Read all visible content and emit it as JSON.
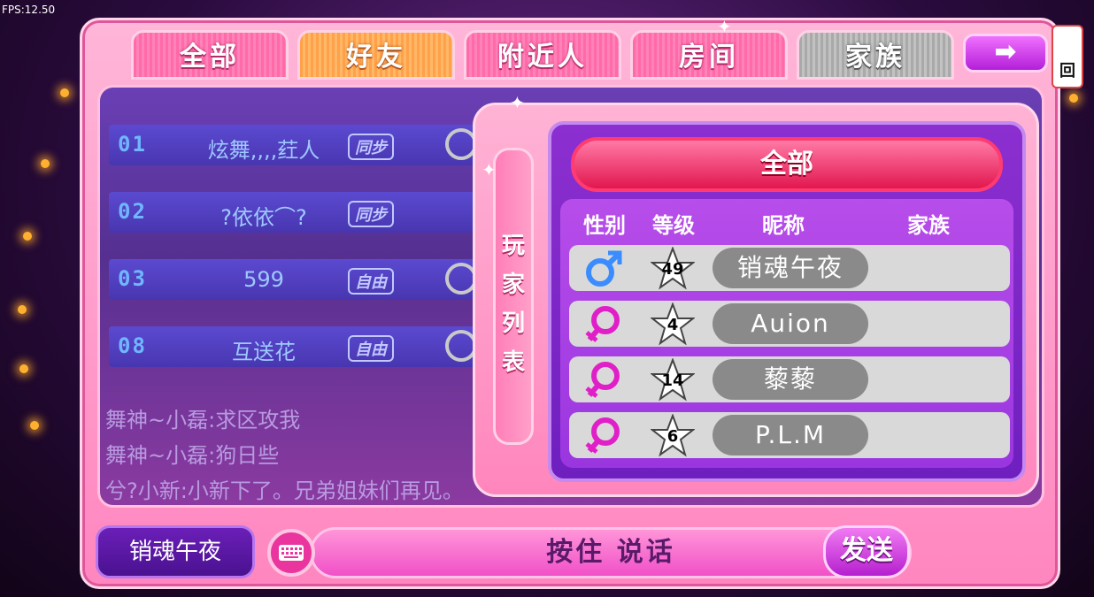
{
  "fps": "FPS:12.50",
  "tabs": [
    {
      "label": "全部",
      "state": "normal"
    },
    {
      "label": "好友",
      "state": "active"
    },
    {
      "label": "附近人",
      "state": "normal"
    },
    {
      "label": "房间",
      "state": "normal"
    },
    {
      "label": "家族",
      "state": "disabled"
    }
  ],
  "arrow_button": "➡",
  "back_label": "回",
  "rooms": [
    {
      "num": "01",
      "name": "炫舞,,,,荭人",
      "mode": "同步"
    },
    {
      "num": "02",
      "name": "?依依⌒?",
      "mode": "同步"
    },
    {
      "num": "03",
      "name": "599",
      "mode": "自由"
    },
    {
      "num": "08",
      "name": "互送花",
      "mode": "自由"
    }
  ],
  "chat": [
    "舞神~小磊:求区攻我",
    "舞神~小磊:狗日些",
    "兮?小新:小新下了。兄弟姐妹们再见。"
  ],
  "player_list": {
    "side_title": [
      "玩",
      "家",
      "列",
      "表"
    ],
    "filter_button": "全部",
    "headers": {
      "gender": "性别",
      "level": "等级",
      "nickname": "昵称",
      "family": "家族"
    },
    "players": [
      {
        "gender": "male",
        "gender_icon": "male-icon",
        "level": "49",
        "nickname": "销魂午夜",
        "family": ""
      },
      {
        "gender": "female",
        "gender_icon": "female-icon",
        "level": "4",
        "nickname": "Auion",
        "family": ""
      },
      {
        "gender": "female",
        "gender_icon": "female-icon",
        "level": "14",
        "nickname": "藜藜",
        "family": ""
      },
      {
        "gender": "female",
        "gender_icon": "female-icon",
        "level": "6",
        "nickname": "P.L.M",
        "family": ""
      }
    ]
  },
  "bottom": {
    "player_name": "销魂午夜",
    "keyboard_icon": "keyboard-icon",
    "voice_label": "按住 说话",
    "send_label": "发送"
  },
  "colors": {
    "male": "#3a8cff",
    "female": "#e01fc8",
    "frame": "#ff86bf"
  }
}
